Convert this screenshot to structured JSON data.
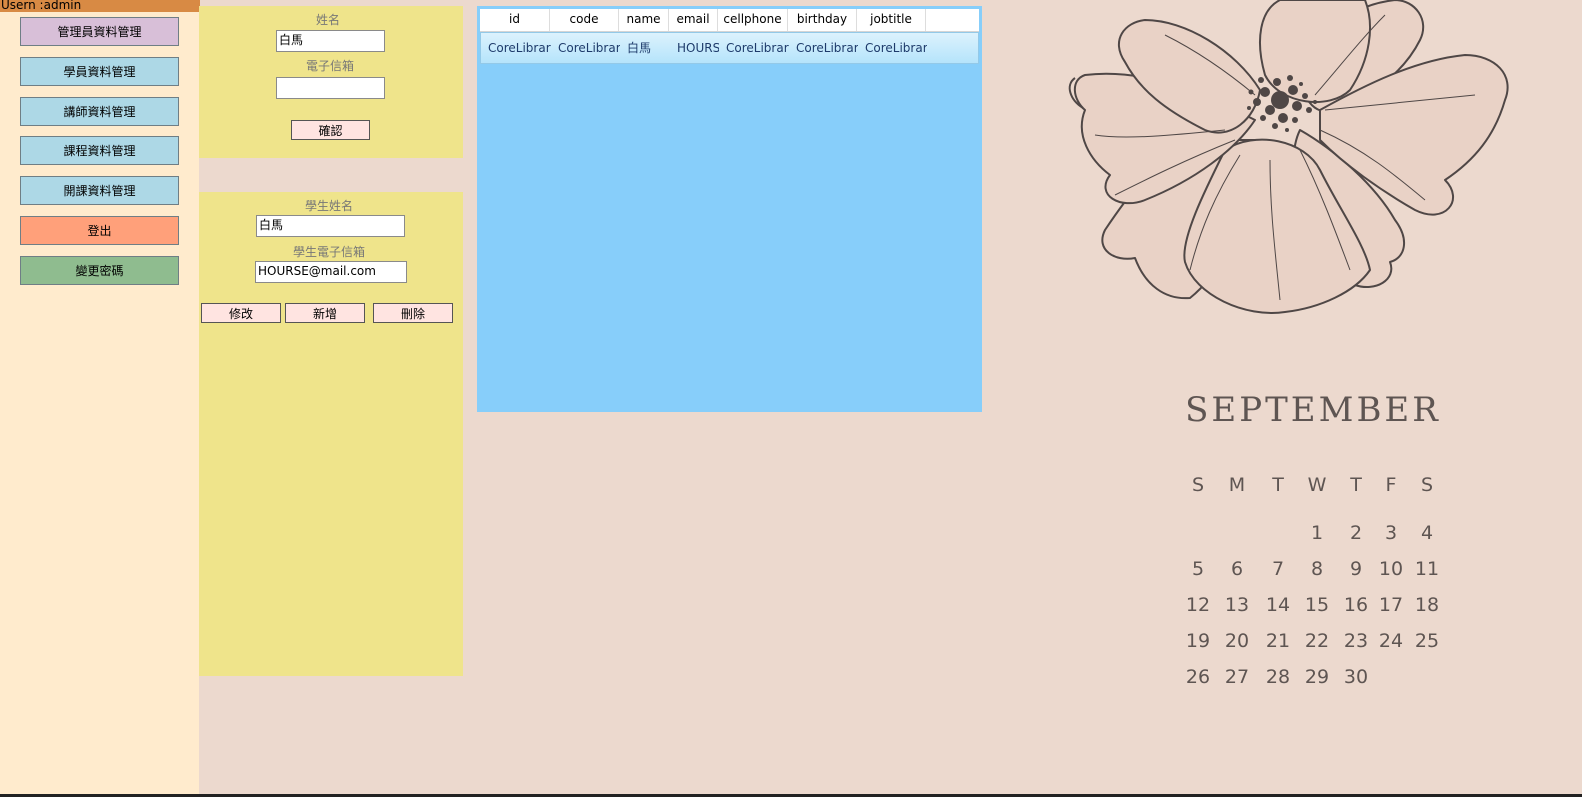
{
  "user_bar": "Usern :admin",
  "sidebar": {
    "buttons": [
      {
        "label": "管理員資料管理",
        "color": "#d8bfd8"
      },
      {
        "label": "學員資料管理",
        "color": "#add8e6"
      },
      {
        "label": "講師資料管理",
        "color": "#add8e6"
      },
      {
        "label": "課程資料管理",
        "color": "#add8e6"
      },
      {
        "label": "開課資料管理",
        "color": "#add8e6"
      },
      {
        "label": "登出",
        "color": "#ffa07a"
      },
      {
        "label": "變更密碼",
        "color": "#8fbc8f"
      }
    ]
  },
  "search_panel": {
    "name_label": "姓名",
    "name_value": "白馬",
    "email_label": "電子信箱",
    "email_value": "",
    "confirm_label": "確認"
  },
  "edit_panel": {
    "student_name_label": "學生姓名",
    "student_name_value": "白馬",
    "student_email_label": "學生電子信箱",
    "student_email_value": "HOURSE@mail.com",
    "modify_label": "修改",
    "add_label": "新增",
    "delete_label": "刪除"
  },
  "grid": {
    "columns": [
      "id",
      "code",
      "name",
      "email",
      "cellphone",
      "birthday",
      "jobtitle"
    ],
    "rows": [
      [
        "CoreLibrar",
        "CoreLibrar",
        "白馬",
        "HOURS",
        "CoreLibrar",
        "CoreLibrar",
        "CoreLibrar"
      ]
    ]
  },
  "calendar": {
    "month": "SEPTEMBER",
    "weekdays": [
      "S",
      "M",
      "T",
      "W",
      "T",
      "F",
      "S"
    ],
    "weeks": [
      [
        "",
        "",
        "",
        "1",
        "2",
        "3",
        "4"
      ],
      [
        "5",
        "6",
        "7",
        "8",
        "9",
        "10",
        "11"
      ],
      [
        "12",
        "13",
        "14",
        "15",
        "16",
        "17",
        "18"
      ],
      [
        "19",
        "20",
        "21",
        "22",
        "23",
        "24",
        "25"
      ],
      [
        "26",
        "27",
        "28",
        "29",
        "30",
        "",
        ""
      ]
    ]
  },
  "icons": {
    "flower": "flower-illustration-icon"
  }
}
